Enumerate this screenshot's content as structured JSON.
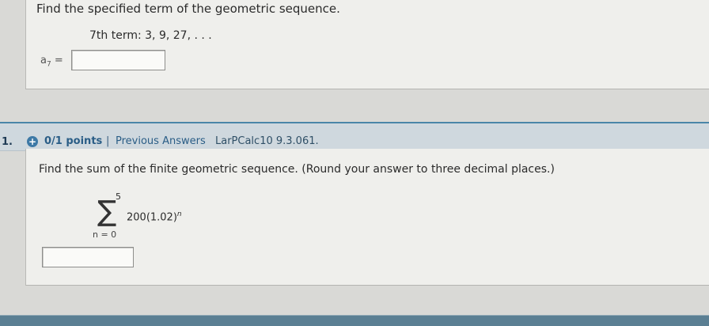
{
  "q_top": {
    "prompt": "Find the specified term of the geometric sequence.",
    "term_description": "7th term: 3, 9, 27, . . .",
    "answer_label_var": "a",
    "answer_label_sub": "7",
    "answer_label_eq": "=",
    "answer_value": ""
  },
  "q_bottom": {
    "number": "1.",
    "points": "0/1 points",
    "separator": "|",
    "previous_answers": "Previous Answers",
    "code": "LarPCalc10 9.3.061.",
    "prompt": "Find the sum of the finite geometric sequence. (Round your answer to three decimal places.)",
    "sum_upper": "5",
    "sum_symbol": "∑",
    "sum_lower": "n = 0",
    "sum_term_base": "200(1.02)",
    "sum_term_exp": "n",
    "answer_value": ""
  },
  "colors": {
    "bar_accent": "#4a86a8",
    "link": "#2a5d86",
    "page_bg": "#d9d9d6"
  }
}
